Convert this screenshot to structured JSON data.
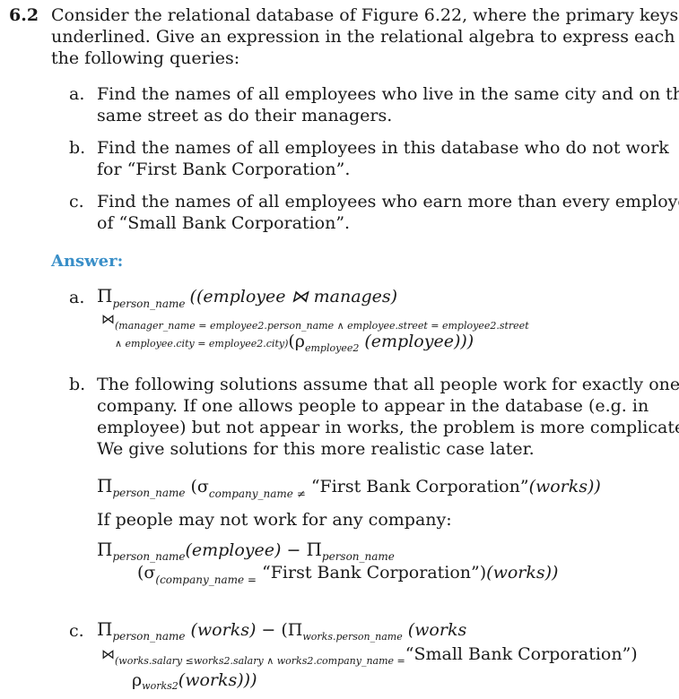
{
  "exercise": {
    "number": "6.2",
    "intro_lines": [
      "Consider the relational database of Figure 6.22, where the primary keys are",
      "underlined. Give an expression in the relational algebra to express each of",
      "the following queries:"
    ],
    "parts": [
      {
        "label": "a.",
        "lines": [
          "Find the names of all employees who live in the same city and on the",
          "same street as do their managers."
        ]
      },
      {
        "label": "b.",
        "lines": [
          "Find the names of all employees in this database who do not work",
          "for “First Bank Corporation”."
        ]
      },
      {
        "label": "c.",
        "lines": [
          "Find the names of all employees who earn more than every employee",
          "of “Small Bank Corporation”."
        ]
      }
    ]
  },
  "answer_heading": "Answer:",
  "answers": {
    "a": {
      "label": "a.",
      "pi": "Π",
      "pi_sub": "person_name",
      "expr1": "((employee  ⋈  manages)",
      "join_sym": "⋈",
      "cond1": "(manager_name = employee2.person_name ∧ employee.street = employee2.street",
      "cond2": "∧ employee.city = employee2.city)",
      "rho_part": "(ρ",
      "rho_sub": "employee2",
      "rho_arg": " (employee)))"
    },
    "b": {
      "label": "b.",
      "para": [
        "The following solutions assume that all people work for exactly one",
        "company. If one allows people to appear in the database (e.g. in",
        "employee) but not appear in works, the problem is more complicated.",
        "We give solutions for this more realistic case later."
      ],
      "expr1_pi": "Π",
      "expr1_pi_sub": "person_name",
      "expr1_sigma": " (σ",
      "expr1_sigma_sub": "company_name ≠",
      "expr1_str": " “First Bank Corporation”",
      "expr1_tail": "(works))",
      "middle": "If people may not work for any company:",
      "expr2_pi": "Π",
      "expr2_pi_sub": "person_name",
      "expr2_emp": "(employee)",
      "expr2_minus": "  −  ",
      "expr2_pi2": "Π",
      "expr2_pi2_sub": "person_name",
      "expr3_sigma": "(σ",
      "expr3_sigma_sub": "(company_name =",
      "expr3_str": " “First Bank Corporation”)",
      "expr3_tail": "(works))"
    },
    "c": {
      "label": "c.",
      "pi": "Π",
      "pi_sub": "person_name",
      "works": " (works)",
      "minus": "  −  ",
      "pi2": "(Π",
      "pi2_sub": "works.person_name",
      "works2": " (works",
      "join_sym": "⋈",
      "cond": "(works.salary ≤works2.salary ∧ works2.company_name =",
      "cond_str": "“Small Bank Corporation”)",
      "rho": "ρ",
      "rho_sub": "works2",
      "rho_arg": "(works)))"
    }
  }
}
